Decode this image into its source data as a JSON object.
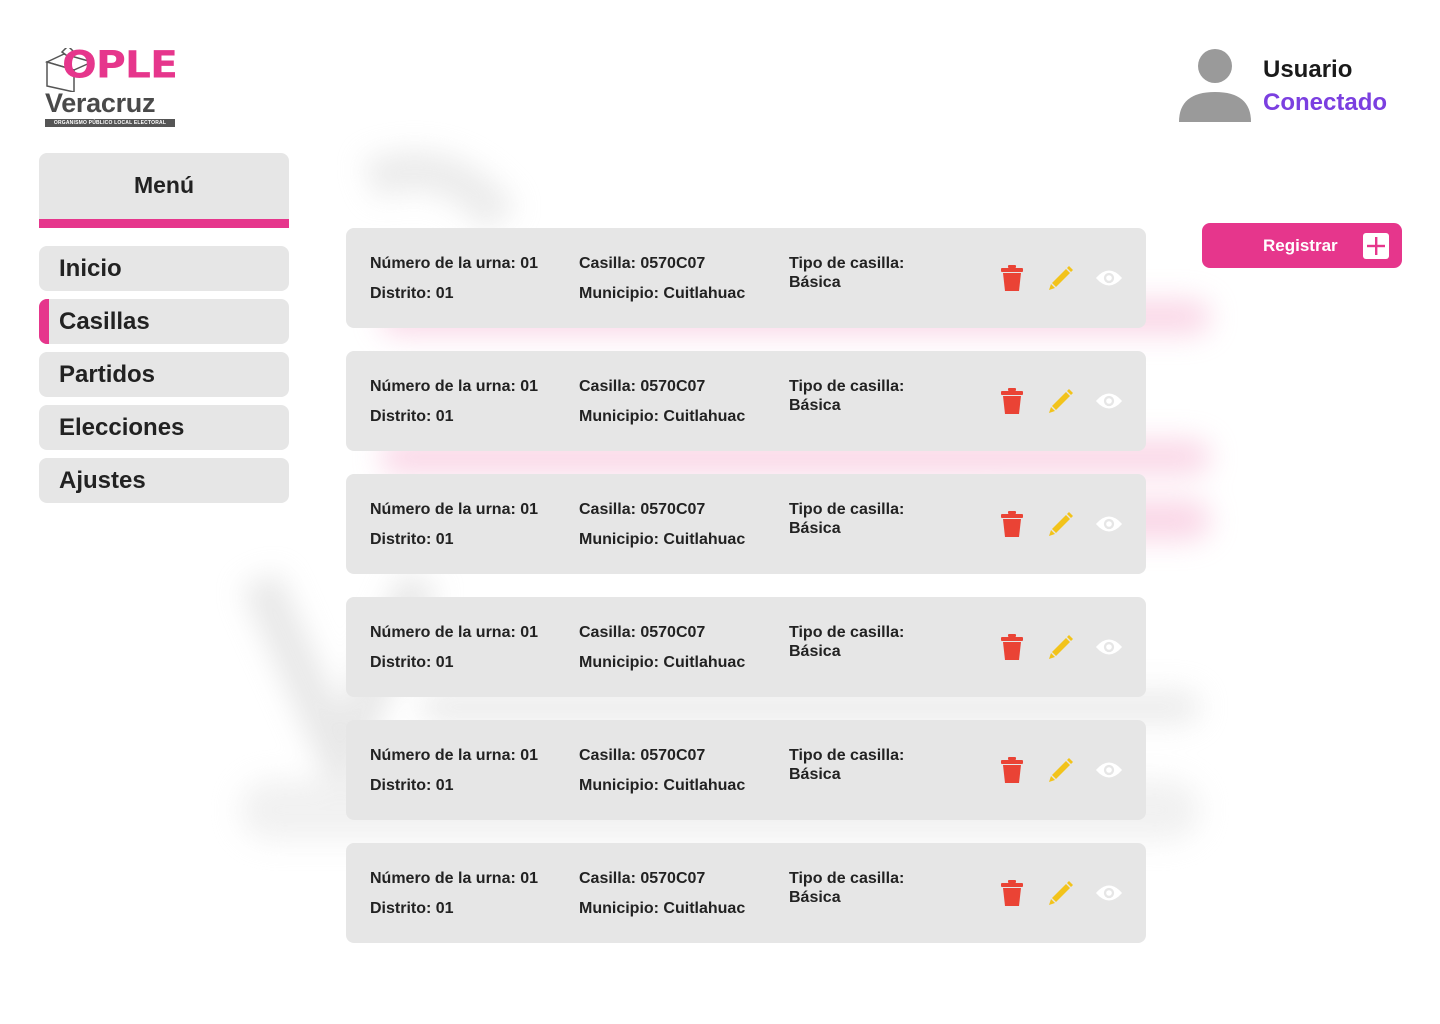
{
  "brand": {
    "logo_main": "OPLE",
    "logo_region": "Veracruz",
    "logo_subtitle": "ORGANISMO PÚBLICO LOCAL ELECTORAL"
  },
  "user": {
    "name": "Usuario",
    "status": "Conectado",
    "status_color": "#7b3fe0"
  },
  "colors": {
    "accent": "#e6368c",
    "delete": "#ea4335",
    "edit": "#f2c31b",
    "view": "#ffffff",
    "card_bg": "#e6e6e6"
  },
  "sidebar": {
    "title": "Menú",
    "items": [
      {
        "label": "Inicio",
        "active": false
      },
      {
        "label": "Casillas",
        "active": true
      },
      {
        "label": "Partidos",
        "active": false
      },
      {
        "label": "Elecciones",
        "active": false
      },
      {
        "label": "Ajustes",
        "active": false
      }
    ]
  },
  "actions": {
    "register_label": "Registrar",
    "register_icon": "plus-square-icon"
  },
  "records": [
    {
      "urna": "Número de la urna: 01",
      "distrito": "Distrito: 01",
      "casilla": "Casilla: 0570C07",
      "municipio": "Municipio: Cuitlahuac",
      "tipo_label": "Tipo de casilla:",
      "tipo": "Básica"
    },
    {
      "urna": "Número de la urna: 01",
      "distrito": "Distrito: 01",
      "casilla": "Casilla: 0570C07",
      "municipio": "Municipio: Cuitlahuac",
      "tipo_label": "Tipo de casilla:",
      "tipo": "Básica"
    },
    {
      "urna": "Número de la urna: 01",
      "distrito": "Distrito: 01",
      "casilla": "Casilla: 0570C07",
      "municipio": "Municipio: Cuitlahuac",
      "tipo_label": "Tipo de casilla:",
      "tipo": "Básica"
    },
    {
      "urna": "Número de la urna: 01",
      "distrito": "Distrito: 01",
      "casilla": "Casilla: 0570C07",
      "municipio": "Municipio: Cuitlahuac",
      "tipo_label": "Tipo de casilla:",
      "tipo": "Básica"
    },
    {
      "urna": "Número de la urna: 01",
      "distrito": "Distrito: 01",
      "casilla": "Casilla: 0570C07",
      "municipio": "Municipio: Cuitlahuac",
      "tipo_label": "Tipo de casilla:",
      "tipo": "Básica"
    },
    {
      "urna": "Número de la urna: 01",
      "distrito": "Distrito: 01",
      "casilla": "Casilla: 0570C07",
      "municipio": "Municipio: Cuitlahuac",
      "tipo_label": "Tipo de casilla:",
      "tipo": "Básica"
    }
  ],
  "row_icons": [
    "trash-icon",
    "pencil-icon",
    "eye-icon"
  ]
}
